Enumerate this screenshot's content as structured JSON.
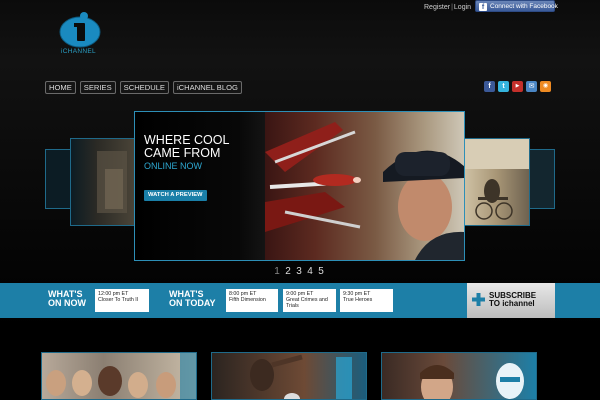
{
  "header": {
    "logo_text": "iCHANNEL",
    "register_label": "Register",
    "login_label": "Login",
    "facebook_connect_label": "Connect with Facebook"
  },
  "nav": {
    "items": [
      {
        "label": "HOME"
      },
      {
        "label": "SERIES"
      },
      {
        "label": "SCHEDULE"
      },
      {
        "label": "iCHANNEL BLOG"
      }
    ]
  },
  "social": {
    "icons": [
      "facebook-icon",
      "twitter-icon",
      "youtube-icon",
      "email-icon",
      "rss-icon"
    ]
  },
  "hero": {
    "title": "WHERE COOL CAME FROM",
    "subtitle": "ONLINE NOW",
    "cta_label": "WATCH A PREVIEW"
  },
  "pager": {
    "pages": [
      "1",
      "2",
      "3",
      "4",
      "5"
    ],
    "active": "1"
  },
  "schedule": {
    "now_label_1": "WHAT'S",
    "now_label_2": "ON NOW",
    "today_label_1": "WHAT'S",
    "today_label_2": "ON TODAY",
    "now": {
      "time": "12:00 pm ET",
      "title": "Closer To Truth II"
    },
    "today": [
      {
        "time": "8:00 pm ET",
        "title": "Fifth Dimension"
      },
      {
        "time": "9:00 pm ET",
        "title": "Great Crimes and Trials"
      },
      {
        "time": "9:30 pm ET",
        "title": "True Heroes"
      }
    ]
  },
  "subscribe": {
    "line1": "SUBSCRIBE",
    "line2": "TO ichannel"
  },
  "colors": {
    "accent_blue": "#1d7fa7",
    "link_blue": "#2ea8d1",
    "background": "#050505"
  }
}
